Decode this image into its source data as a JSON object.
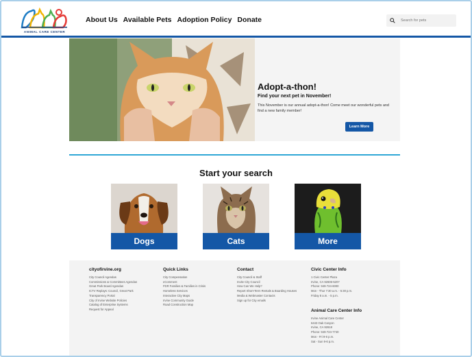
{
  "logo": {
    "text": "ANIMAL CARE CENTER"
  },
  "nav": [
    {
      "label": "About Us"
    },
    {
      "label": "Available Pets"
    },
    {
      "label": "Adoption Policy"
    },
    {
      "label": "Donate"
    }
  ],
  "search": {
    "placeholder": "Search for pets"
  },
  "hero": {
    "title": "Adopt-a-thon!",
    "subtitle": "Find your next pet in November!",
    "description": "This November is our annual adopt-a-thon! Come meet our wonderful pets and find a new family member!",
    "button": "Learn More"
  },
  "start": {
    "heading": "Start your search"
  },
  "cards": [
    {
      "label": "Dogs"
    },
    {
      "label": "Cats"
    },
    {
      "label": "More"
    }
  ],
  "footer": {
    "col1": {
      "title": "cityofirvine.org",
      "items": [
        "City Council Agendas",
        "Commissions & Committees Agendas",
        "Great Park Board Agendas",
        "ICTV Replays: Council, Great Park",
        "Transparency Portal",
        "City of Irvine Website Policies",
        "Catalog of Enterprise Systems",
        "Request for Appeal"
      ]
    },
    "col2": {
      "title": "Quick Links",
      "items": [
        "City Compensation",
        "eComment",
        "FDR Families & Families in Crisis",
        "Homeless Services",
        "Interactive City Maps",
        "Irvine Community Guide",
        "Road Construction Map"
      ]
    },
    "col3": {
      "title": "Contact",
      "items": [
        "City Council & Staff",
        "Invite City Council",
        "How Can We Help?",
        "Report Short-Term Rentals & Boarding Houses",
        "Media & Webmaster Contacts",
        "Sign up for City emails"
      ]
    },
    "col4": {
      "title": "Civic Center Info",
      "items": [
        "1 Civic Center Plaza",
        "Irvine, CA 92606-5207",
        "Phone: 949-724-6000",
        "Mon - Thur 7:30 a.m. - 5:30 p.m.",
        "Friday 8 a.m. - 5 p.m."
      ]
    },
    "col5": {
      "title": "Animal Care Center Info",
      "items": [
        "Irvine Animal Care Center",
        "6443 Oak Canyon",
        "Irvine, CA 92618",
        "Phone: 949-724-7740",
        "Mon - Fri 9-6 p.m.",
        "Sat - Sun 9-6 p.m."
      ]
    }
  },
  "colors": {
    "brand_blue": "#1457a6",
    "divider_teal": "#2ea7d6",
    "footer_bg": "#f3f3f3"
  }
}
